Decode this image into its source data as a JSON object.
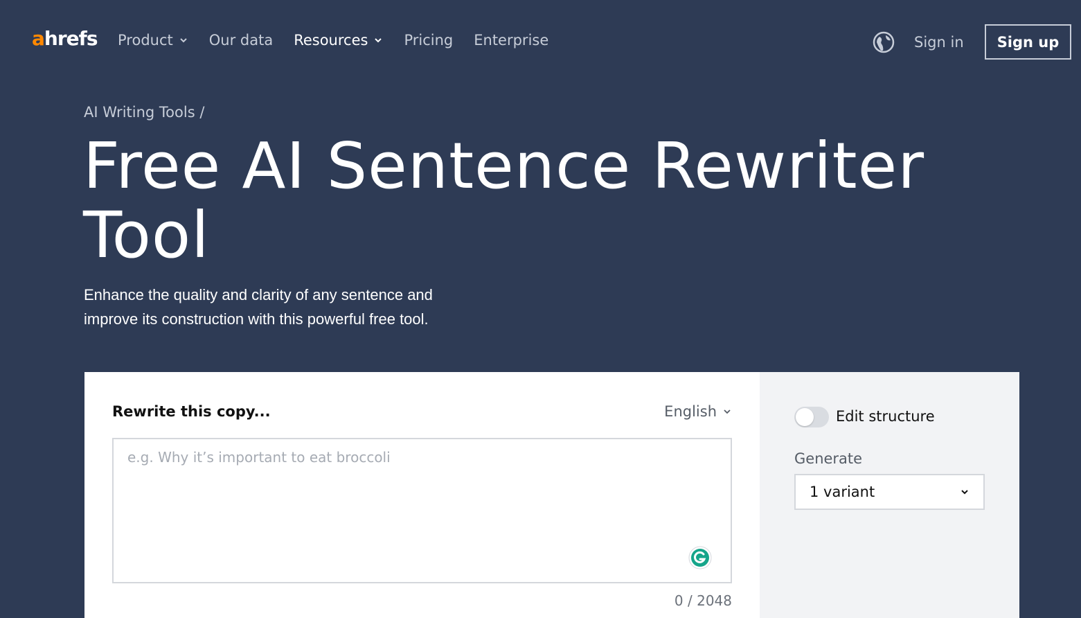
{
  "nav": {
    "logo_a": "a",
    "logo_rest": "hrefs",
    "items": [
      {
        "label": "Product",
        "has_dropdown": true,
        "active": false
      },
      {
        "label": "Our data",
        "has_dropdown": false,
        "active": false
      },
      {
        "label": "Resources",
        "has_dropdown": true,
        "active": true
      },
      {
        "label": "Pricing",
        "has_dropdown": false,
        "active": false
      },
      {
        "label": "Enterprise",
        "has_dropdown": false,
        "active": false
      }
    ],
    "globe_icon": "globe-icon",
    "sign_in": "Sign in",
    "sign_up": "Sign up"
  },
  "hero": {
    "breadcrumb": "AI Writing Tools /",
    "title": "Free AI Sentence Rewriter Tool",
    "subtitle": "Enhance the quality and clarity of any sentence and improve its construction with this powerful free tool."
  },
  "tool": {
    "rewrite_label": "Rewrite this copy...",
    "language": "English",
    "placeholder": "e.g. Why it’s important to eat broccoli",
    "counter": "0 / 2048",
    "edit_structure_label": "Edit structure",
    "edit_structure_on": false,
    "generate_label": "Generate",
    "generate_value": "1 variant"
  },
  "colors": {
    "background": "#2e3b55",
    "brand_orange": "#ff8800",
    "grammarly_green": "#15a58a"
  }
}
